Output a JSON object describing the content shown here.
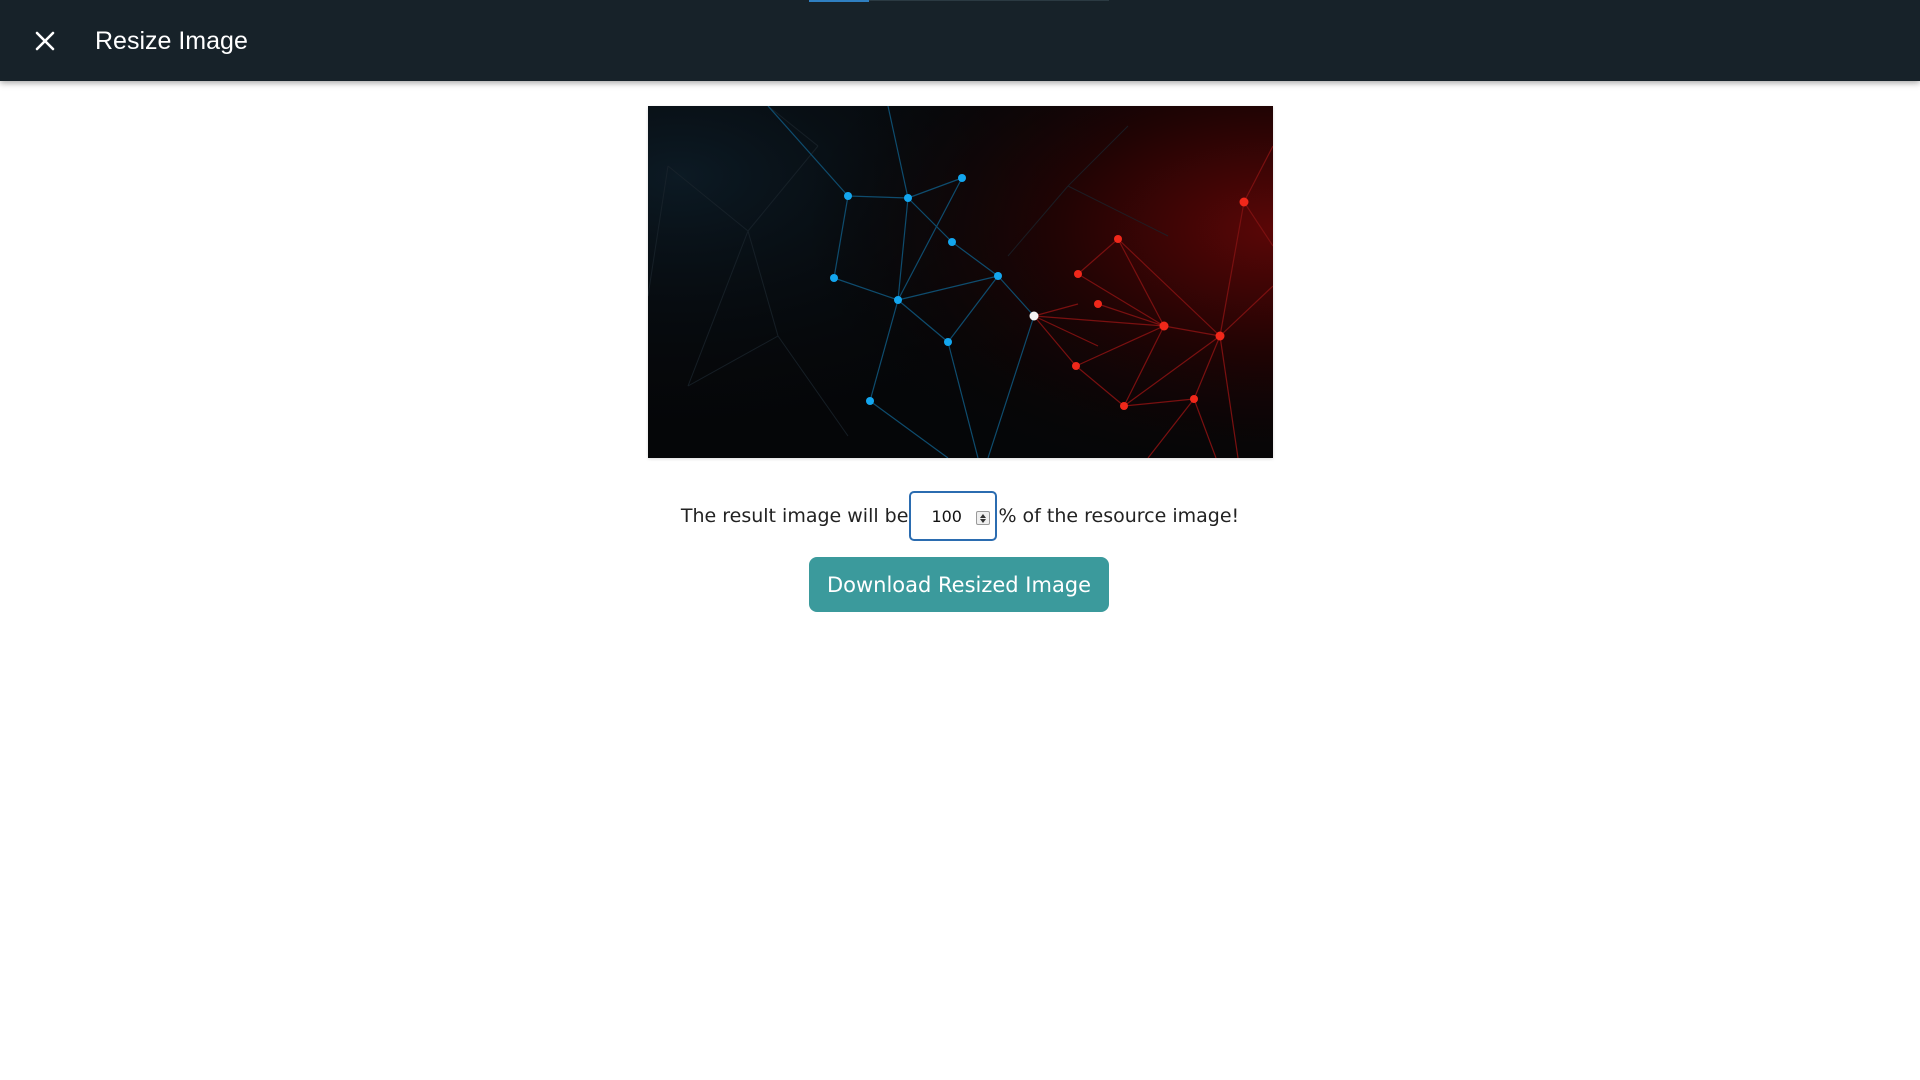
{
  "header": {
    "title": "Resize Image",
    "close_icon": "close-icon"
  },
  "preview": {
    "icon": "network-nodes-image"
  },
  "scale": {
    "prefix": "The result image will be",
    "value": "100",
    "suffix": "% of the resource image!"
  },
  "actions": {
    "download_label": "Download Resized Image"
  },
  "colors": {
    "header_bg": "#172229",
    "accent": "#3b9a9c",
    "focus_border": "#2b6cb0"
  }
}
